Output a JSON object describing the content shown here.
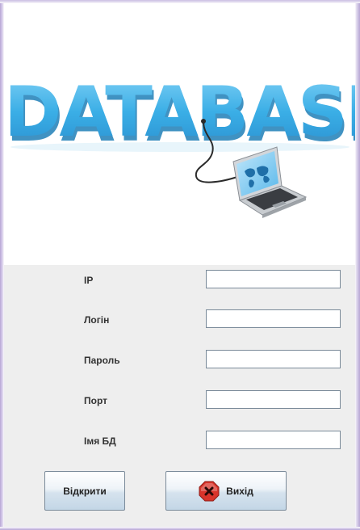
{
  "banner": {
    "logo_text": "DATABASE",
    "accent_color": "#3aaee6",
    "shadow_color": "#1f7fb8"
  },
  "form": {
    "fields": [
      {
        "label": "IP",
        "value": ""
      },
      {
        "label": "Логін",
        "value": ""
      },
      {
        "label": "Пароль",
        "value": ""
      },
      {
        "label": "Порт",
        "value": ""
      },
      {
        "label": "Імя БД",
        "value": ""
      }
    ]
  },
  "buttons": {
    "open_label": "Відкрити",
    "exit_label": "Вихід",
    "exit_icon": "close-x-icon",
    "exit_icon_color": "#d9342b"
  }
}
